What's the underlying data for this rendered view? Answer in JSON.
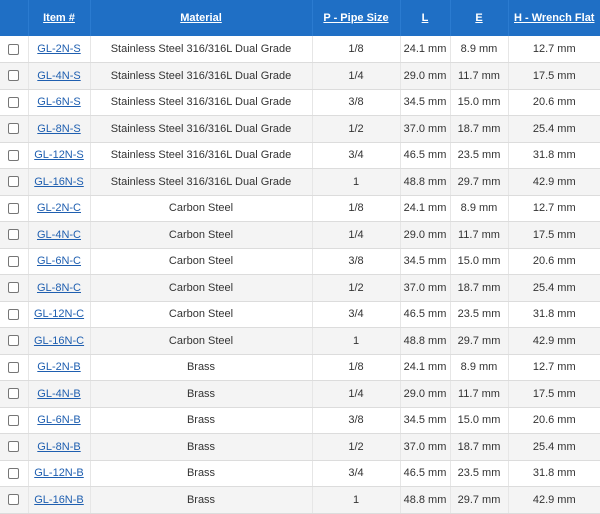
{
  "table": {
    "headers": {
      "select": "",
      "item": "Item #",
      "material": "Material",
      "pipe_size": "P - Pipe Size",
      "l": "L",
      "e": "E",
      "h": "H - Wrench Flat"
    },
    "rows": [
      {
        "item": "GL-2N-S",
        "material": "Stainless Steel 316/316L Dual Grade",
        "pipe_size": "1/8",
        "l": "24.1 mm",
        "e": "8.9 mm",
        "h": "12.7 mm"
      },
      {
        "item": "GL-4N-S",
        "material": "Stainless Steel 316/316L Dual Grade",
        "pipe_size": "1/4",
        "l": "29.0 mm",
        "e": "11.7 mm",
        "h": "17.5 mm"
      },
      {
        "item": "GL-6N-S",
        "material": "Stainless Steel 316/316L Dual Grade",
        "pipe_size": "3/8",
        "l": "34.5 mm",
        "e": "15.0 mm",
        "h": "20.6 mm"
      },
      {
        "item": "GL-8N-S",
        "material": "Stainless Steel 316/316L Dual Grade",
        "pipe_size": "1/2",
        "l": "37.0 mm",
        "e": "18.7 mm",
        "h": "25.4 mm"
      },
      {
        "item": "GL-12N-S",
        "material": "Stainless Steel 316/316L Dual Grade",
        "pipe_size": "3/4",
        "l": "46.5 mm",
        "e": "23.5 mm",
        "h": "31.8 mm"
      },
      {
        "item": "GL-16N-S",
        "material": "Stainless Steel 316/316L Dual Grade",
        "pipe_size": "1",
        "l": "48.8 mm",
        "e": "29.7 mm",
        "h": "42.9 mm"
      },
      {
        "item": "GL-2N-C",
        "material": "Carbon Steel",
        "pipe_size": "1/8",
        "l": "24.1 mm",
        "e": "8.9 mm",
        "h": "12.7 mm"
      },
      {
        "item": "GL-4N-C",
        "material": "Carbon Steel",
        "pipe_size": "1/4",
        "l": "29.0 mm",
        "e": "11.7 mm",
        "h": "17.5 mm"
      },
      {
        "item": "GL-6N-C",
        "material": "Carbon Steel",
        "pipe_size": "3/8",
        "l": "34.5 mm",
        "e": "15.0 mm",
        "h": "20.6 mm"
      },
      {
        "item": "GL-8N-C",
        "material": "Carbon Steel",
        "pipe_size": "1/2",
        "l": "37.0 mm",
        "e": "18.7 mm",
        "h": "25.4 mm"
      },
      {
        "item": "GL-12N-C",
        "material": "Carbon Steel",
        "pipe_size": "3/4",
        "l": "46.5 mm",
        "e": "23.5 mm",
        "h": "31.8 mm"
      },
      {
        "item": "GL-16N-C",
        "material": "Carbon Steel",
        "pipe_size": "1",
        "l": "48.8 mm",
        "e": "29.7 mm",
        "h": "42.9 mm"
      },
      {
        "item": "GL-2N-B",
        "material": "Brass",
        "pipe_size": "1/8",
        "l": "24.1 mm",
        "e": "8.9 mm",
        "h": "12.7 mm"
      },
      {
        "item": "GL-4N-B",
        "material": "Brass",
        "pipe_size": "1/4",
        "l": "29.0 mm",
        "e": "11.7 mm",
        "h": "17.5 mm"
      },
      {
        "item": "GL-6N-B",
        "material": "Brass",
        "pipe_size": "3/8",
        "l": "34.5 mm",
        "e": "15.0 mm",
        "h": "20.6 mm"
      },
      {
        "item": "GL-8N-B",
        "material": "Brass",
        "pipe_size": "1/2",
        "l": "37.0 mm",
        "e": "18.7 mm",
        "h": "25.4 mm"
      },
      {
        "item": "GL-12N-B",
        "material": "Brass",
        "pipe_size": "3/4",
        "l": "46.5 mm",
        "e": "23.5 mm",
        "h": "31.8 mm"
      },
      {
        "item": "GL-16N-B",
        "material": "Brass",
        "pipe_size": "1",
        "l": "48.8 mm",
        "e": "29.7 mm",
        "h": "42.9 mm"
      }
    ]
  },
  "colors": {
    "header_bg": "#1f6fc5",
    "header_text": "#ffffff",
    "link": "#1f5fb0",
    "row_alt": "#f4f4f4"
  }
}
